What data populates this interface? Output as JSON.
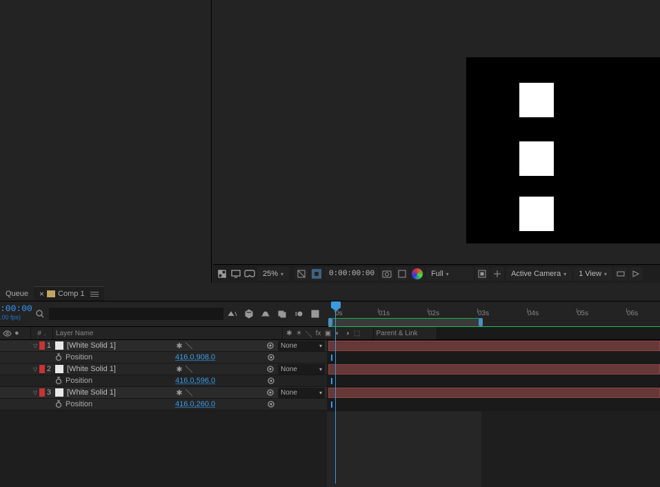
{
  "tabs": {
    "queue": "Queue",
    "comp": "Comp 1"
  },
  "preview": {
    "zoom": "25%",
    "timecode": "0:00:00:00",
    "resolution": "Full",
    "camera": "Active Camera",
    "view": "1 View"
  },
  "timeline_header": {
    "current_time": ":00:00",
    "fps_line": ".00 fps)"
  },
  "columns": {
    "layer_name": "Layer Name",
    "parent_link": "Parent & Link"
  },
  "ruler": [
    "0s",
    "01s",
    "02s",
    "03s",
    "04s",
    "05s",
    "06s"
  ],
  "layers": [
    {
      "index": "1",
      "name": "[White Solid 1]",
      "parent": "None",
      "prop": "Position",
      "value": "416.0,908.0"
    },
    {
      "index": "2",
      "name": "[White Solid 1]",
      "parent": "None",
      "prop": "Position",
      "value": "416.0,596.0"
    },
    {
      "index": "3",
      "name": "[White Solid 1]",
      "parent": "None",
      "prop": "Position",
      "value": "416.0,260.0"
    }
  ]
}
